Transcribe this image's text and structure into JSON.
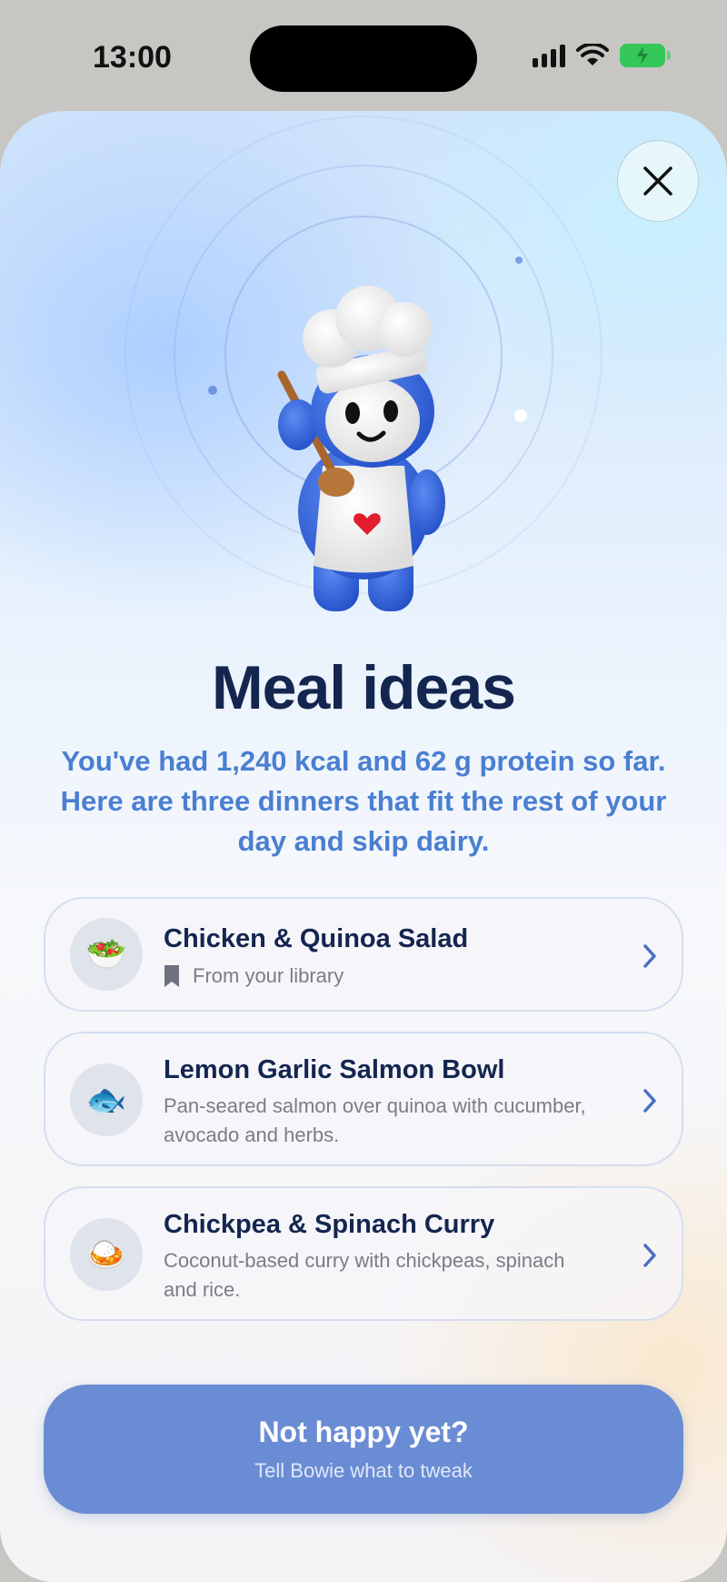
{
  "status_bar": {
    "time": "13:00"
  },
  "close_button": {
    "icon": "close-icon"
  },
  "header": {
    "title": "Meal ideas",
    "subtitle": "You've had 1,240 kcal and 62 g protein so far. Here are three dinners that fit the rest of your day and skip dairy."
  },
  "meals": [
    {
      "title": "Chicken & Quinoa Salad",
      "meta": "From your library",
      "meta_icon": "bookmark-icon",
      "icon": "salad-icon",
      "emoji": "🥗"
    },
    {
      "title": "Lemon Garlic Salmon Bowl",
      "description": "Pan-seared salmon over quinoa with cucumber, avocado and herbs.",
      "icon": "fish-icon",
      "emoji": "🐟"
    },
    {
      "title": "Chickpea & Spinach Curry",
      "description": "Coconut-based curry with chickpeas, spinach and rice.",
      "icon": "curry-icon",
      "emoji": "🍛"
    }
  ],
  "cta": {
    "label": "Not happy yet?",
    "sublabel": "Tell Bowie what to tweak"
  },
  "colors": {
    "title": "#14264f",
    "subtitle": "#4a7fd1",
    "cta": "#6a8cd4",
    "battery": "#35c759"
  }
}
